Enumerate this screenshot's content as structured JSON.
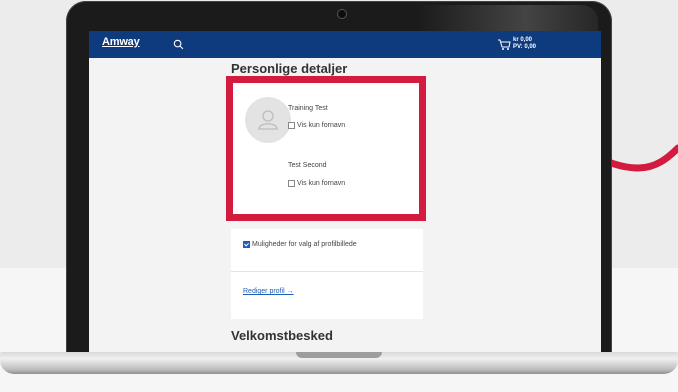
{
  "brand": {
    "logo_text": "Amway"
  },
  "header": {
    "cart_amount": "kr 0,00",
    "cart_points": "PV: 0,00"
  },
  "profile": {
    "section_title": "Personlige detaljer",
    "people": [
      {
        "name": "Training Test",
        "checkbox_label": "Vis kun fornavn"
      },
      {
        "name": "Test Second",
        "checkbox_label": "Vis kun fornavn"
      }
    ],
    "profile_picture_option": "Muligheder for valg af profilbillede",
    "edit_link": "Rediger profil →"
  },
  "welcome": {
    "section_title": "Velkomstbesked"
  },
  "colors": {
    "header_bg": "#0e3b7d",
    "highlight": "#d21b3e",
    "accent_curve": "#d21b3e",
    "link": "#1f5fb8"
  }
}
